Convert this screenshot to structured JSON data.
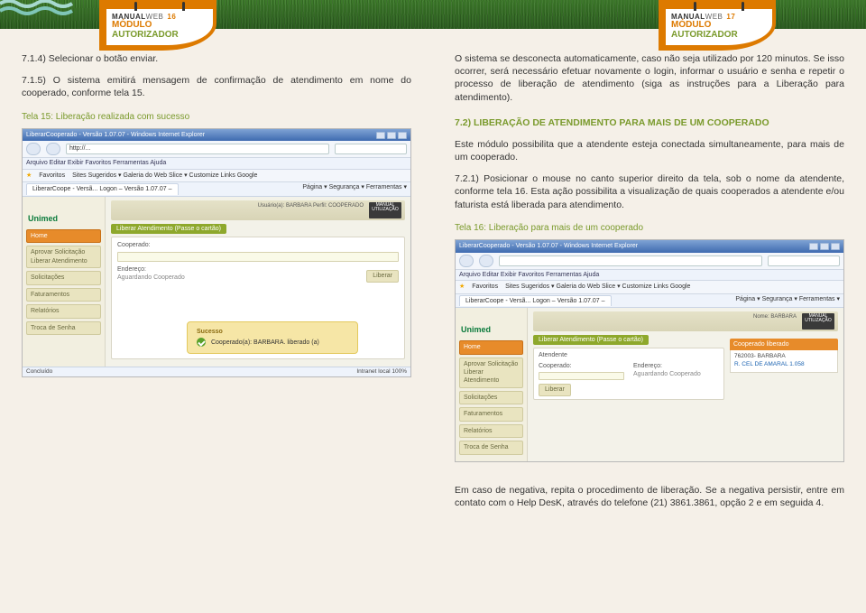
{
  "bookmarks": {
    "left": {
      "brand_a": "MANUAL",
      "brand_b": "WEB",
      "page": "16",
      "mod": "MÓDULO",
      "auth": "AUTORIZADOR"
    },
    "right": {
      "brand_a": "MANUAL",
      "brand_b": "WEB",
      "page": "17",
      "mod": "MÓDULO",
      "auth": "AUTORIZADOR"
    }
  },
  "left_col": {
    "p1": "7.1.4) Selecionar o botão enviar.",
    "p2": "7.1.5) O sistema emitirá mensagem de confirmação de atendimento em nome do cooperado, conforme tela 15.",
    "caption1": "Tela 15: Liberação realizada com sucesso"
  },
  "right_col": {
    "p1": "O sistema se desconecta automaticamente, caso não seja utilizado por 120 minutos. Se isso ocorrer, será necessário efetuar novamente o login, informar o usuário e senha e repetir o processo de liberação de atendimento (siga as instruções para a Liberação para atendimento).",
    "h1": "7.2) LIBERAÇÃO DE ATENDIMENTO PARA MAIS DE UM COOPERADO",
    "p2": "Este módulo possibilita que a atendente esteja conectada simultaneamente, para mais de um cooperado.",
    "p3": "7.2.1) Posicionar o mouse no canto superior direito da tela, sob o nome da atendente, conforme tela 16. Esta ação possibilita a visualização de quais cooperados a atendente e/ou faturista está liberada para atendimento.",
    "caption2": "Tela 16: Liberação para mais de um cooperado",
    "p4": "Em caso de negativa, repita o procedimento de liberação. Se a negativa persistir, entre em contato com o Help DesK, através do telefone (21) 3861.3861, opção 2 e em seguida 4."
  },
  "shot15": {
    "title": "LiberarCooperado - Versão 1.07.07 - Windows Internet Explorer",
    "menubar": "Arquivo   Editar   Exibir   Favoritos   Ferramentas   Ajuda",
    "addr": "http://...",
    "fav_label": "Favoritos",
    "fav_links": "Sites Sugeridos ▾  Galeria do Web Slice ▾  Customize Links  Google",
    "tabs_left": "LiberarCoope - Versã...   Logon – Versão 1.07.07 –",
    "tabs_right": "Página ▾  Segurança ▾  Ferramentas ▾",
    "header_meta": "Usuário(a): BARBARA   Perfil: COOPERADO",
    "manualbox": "MANUAL UTILIZAÇÃO",
    "logo": "Unimed",
    "side": [
      "Home",
      "",
      "Aprovar Solicitação\\nLiberar Atendimento",
      "Solicitações",
      "Faturamentos",
      "Relatórios",
      "Troca de Senha"
    ],
    "chip": "Liberar Atendimento (Passe o cartão)",
    "lbl_coop": "Cooperado:",
    "lbl_end": "Endereço:",
    "val_end": "Aguardando Cooperado",
    "btn": "Liberar",
    "toast_title": "Sucesso",
    "toast_msg": "Cooperado(a): BARBARA. liberado (a)",
    "status_left": "Concluído",
    "status_right": "Intranet local     100%"
  },
  "shot16": {
    "title": "LiberarCooperado - Versão 1.07.07 - Windows Internet Explorer",
    "menubar": "Arquivo   Editar   Exibir   Favoritos   Ferramentas   Ajuda",
    "fav_label": "Favoritos",
    "fav_links": "Sites Sugeridos ▾  Galeria do Web Slice ▾  Customize Links  Google",
    "tabs_left": "LiberarCoope - Versã...   Logon – Versão 1.07.07 –",
    "tabs_right": "Página ▾  Segurança ▾  Ferramentas ▾",
    "header_meta": "Nome: BARBARA",
    "manualbox": "MANUAL UTILIZAÇÃO",
    "logo": "Unimed",
    "side": [
      "Home",
      "",
      "Aprovar Solicitação\\nLiberar Atendimento",
      "Solicitações",
      "Faturamentos",
      "Relatórios",
      "Troca de Senha"
    ],
    "chip": "Liberar Atendimento (Passe o cartão)",
    "coop_block_title": "Cooperado liberado",
    "coop_line1": "762003- BARBARA",
    "coop_line2": "R. CEL DE AMARAL 1.058",
    "lbl_atend": "Atendente",
    "lbl_coop": "Cooperado:",
    "lbl_end": "Endereço:",
    "val_end": "Aguardando Cooperado",
    "btn": "Liberar"
  }
}
